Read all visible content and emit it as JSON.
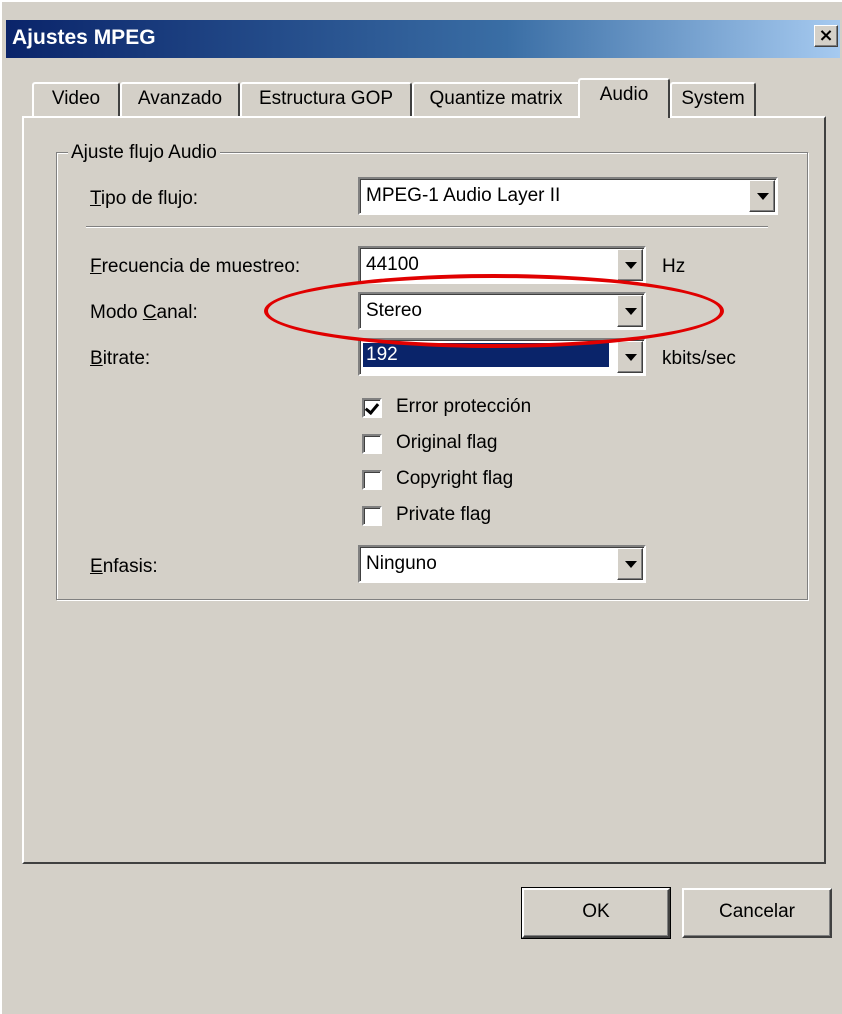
{
  "window": {
    "title": "Ajustes MPEG",
    "close_symbol": "×"
  },
  "tabs": [
    {
      "label": "Video",
      "active": false
    },
    {
      "label": "Avanzado",
      "active": false
    },
    {
      "label": "Estructura GOP",
      "active": false
    },
    {
      "label": "Quantize matrix",
      "active": false
    },
    {
      "label": "Audio",
      "active": true
    },
    {
      "label": "System",
      "active": false
    }
  ],
  "group": {
    "label": "Ajuste flujo Audio"
  },
  "fields": {
    "stream_type": {
      "label": "Tipo de flujo:",
      "value": "MPEG-1 Audio Layer II"
    },
    "sample_rate": {
      "label": "Frecuencia de muestreo:",
      "value": "44100",
      "unit": "Hz"
    },
    "channel_mode": {
      "label": "Modo Canal:",
      "value": "Stereo"
    },
    "bitrate": {
      "label": "Bitrate:",
      "value": "192",
      "unit": "kbits/sec"
    },
    "emphasis": {
      "label": "Enfasis:",
      "value": "Ninguno"
    }
  },
  "checkboxes": [
    {
      "label": "Error protección",
      "checked": true
    },
    {
      "label": "Original flag",
      "checked": false
    },
    {
      "label": "Copyright flag",
      "checked": false
    },
    {
      "label": "Private flag",
      "checked": false
    }
  ],
  "buttons": {
    "ok": "OK",
    "cancel": "Cancelar"
  },
  "colors": {
    "titlebar": "#0a246a",
    "face": "#d4d0c8",
    "highlight_ellipse": "#e00000"
  }
}
